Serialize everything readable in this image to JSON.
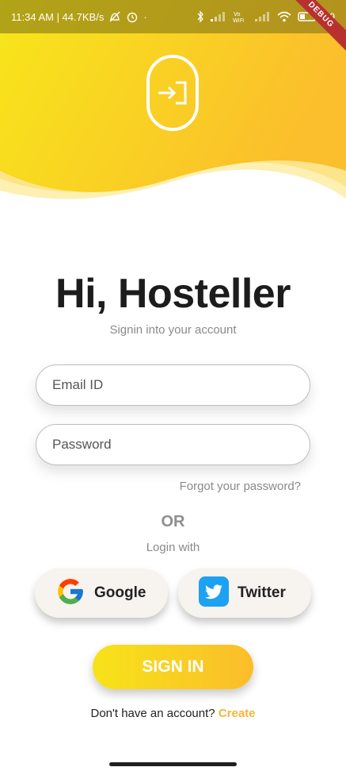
{
  "status_bar": {
    "time_speed": "11:34 AM | 44.7KB/s",
    "dot": "·",
    "battery": "29",
    "debug": "DEBUG",
    "vowifi": "Vo\nWiFi"
  },
  "header": {
    "logo_icon": "login-door-icon",
    "gradient": [
      "#f8e518",
      "#fbc12a"
    ]
  },
  "main": {
    "title": "Hi, Hosteller",
    "subtitle": "Signin into your account",
    "email_placeholder": "Email ID",
    "password_placeholder": "Password",
    "forgot": "Forgot your password?",
    "or": "OR",
    "login_with": "Login with",
    "google": "Google",
    "twitter": "Twitter",
    "signin": "SIGN IN",
    "no_account": "Don't have an account?",
    "create": "Create"
  },
  "colors": {
    "accent": "#f4b73a",
    "yellow": "#f8e518",
    "twitter_blue": "#1da1f2"
  }
}
